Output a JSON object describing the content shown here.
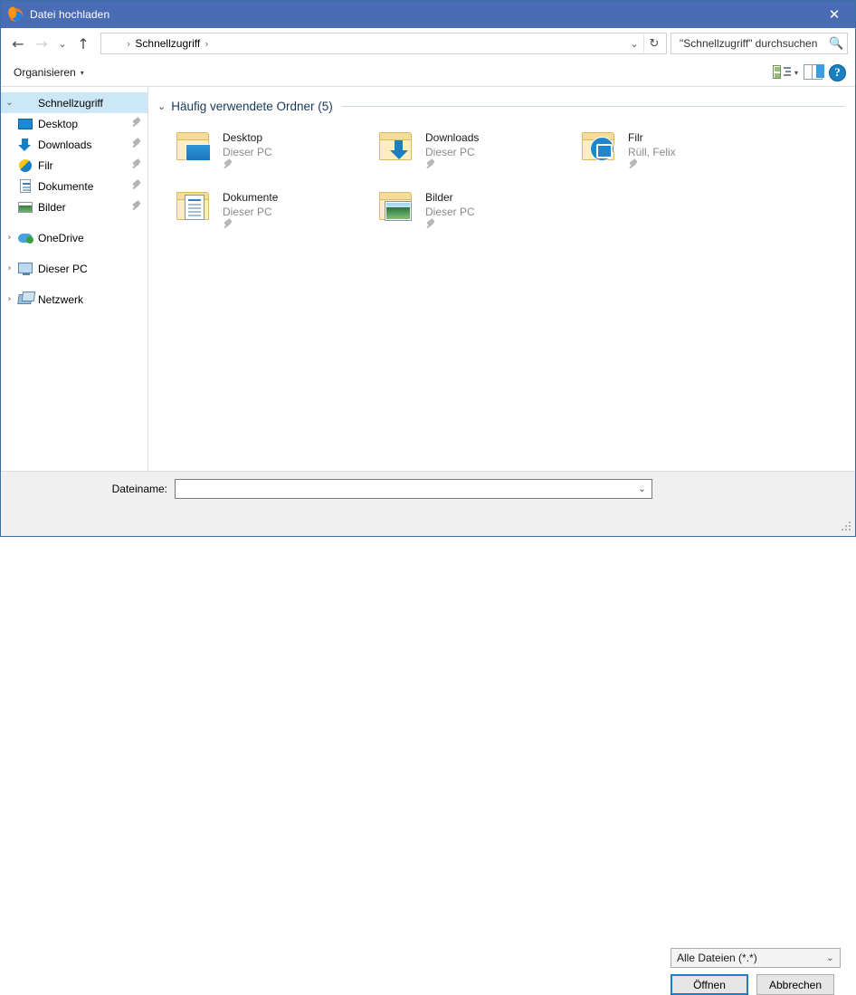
{
  "window": {
    "title": "Datei hochladen",
    "app_icon": "firefox-icon",
    "close_label": "✕"
  },
  "nav": {
    "back_icon": "←",
    "forward_icon": "→",
    "recent_icon": "⌄",
    "up_icon": "↑",
    "breadcrumb": {
      "icon": "quick-access-star-icon",
      "path": "Schnellzugriff",
      "separator": "›"
    },
    "address_dropdown_icon": "⌄",
    "refresh_icon": "↻",
    "search": {
      "placeholder": "\"Schnellzugriff\" durchsuchen",
      "value": "",
      "icon": "search-icon"
    }
  },
  "commandbar": {
    "organize_label": "Organisieren",
    "caret": "▾",
    "view_icon": "view-options-icon",
    "view_caret": "▾",
    "pane_icon": "preview-pane-icon",
    "help_label": "?"
  },
  "sidebar": {
    "items": [
      {
        "label": "Schnellzugriff",
        "icon": "star-icon",
        "expander": "⌄",
        "selected": true,
        "level": 0,
        "pinned": false
      },
      {
        "label": "Desktop",
        "icon": "desktop-icon",
        "expander": "",
        "selected": false,
        "level": 1,
        "pinned": true
      },
      {
        "label": "Downloads",
        "icon": "downloads-icon",
        "expander": "",
        "selected": false,
        "level": 1,
        "pinned": true
      },
      {
        "label": "Filr",
        "icon": "filr-icon",
        "expander": "",
        "selected": false,
        "level": 1,
        "pinned": true
      },
      {
        "label": "Dokumente",
        "icon": "documents-icon",
        "expander": "",
        "selected": false,
        "level": 1,
        "pinned": true
      },
      {
        "label": "Bilder",
        "icon": "pictures-icon",
        "expander": "",
        "selected": false,
        "level": 1,
        "pinned": true
      },
      {
        "label": "OneDrive",
        "icon": "onedrive-icon",
        "expander": "›",
        "selected": false,
        "level": 0,
        "pinned": false
      },
      {
        "label": "Dieser PC",
        "icon": "this-pc-icon",
        "expander": "›",
        "selected": false,
        "level": 0,
        "pinned": false
      },
      {
        "label": "Netzwerk",
        "icon": "network-icon",
        "expander": "›",
        "selected": false,
        "level": 0,
        "pinned": false
      }
    ]
  },
  "content": {
    "group": {
      "chevron": "⌄",
      "title": "Häufig verwendete Ordner (5)"
    },
    "tiles": [
      {
        "name": "Desktop",
        "subtitle": "Dieser PC",
        "icon": "folder-desktop-icon"
      },
      {
        "name": "Downloads",
        "subtitle": "Dieser PC",
        "icon": "folder-downloads-icon"
      },
      {
        "name": "Filr",
        "subtitle": "Rüll, Felix",
        "icon": "folder-filr-icon"
      },
      {
        "name": "Dokumente",
        "subtitle": "Dieser PC",
        "icon": "folder-documents-icon"
      },
      {
        "name": "Bilder",
        "subtitle": "Dieser PC",
        "icon": "folder-pictures-icon"
      }
    ]
  },
  "footer": {
    "filename_label": "Dateiname:",
    "filename_value": "",
    "filename_placeholder": "",
    "filetype_value": "Alle Dateien (*.*)",
    "filetype_caret": "⌄",
    "open_label": "Öffnen",
    "cancel_label": "Abbrechen"
  },
  "colors": {
    "titlebar": "#4a6cb5",
    "selection": "#cce8f7",
    "accent": "#1a7fc1",
    "footer_bg": "#f0f0f0"
  }
}
